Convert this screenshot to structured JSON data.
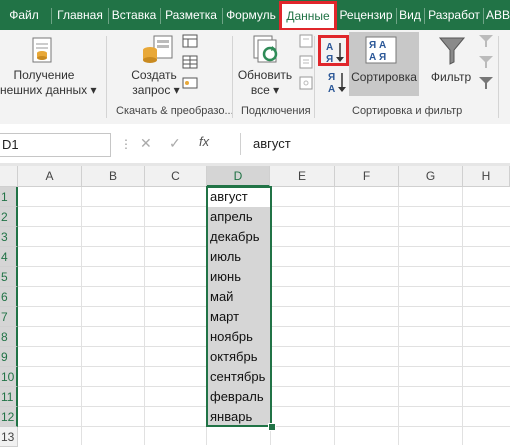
{
  "tabs": [
    "Файл",
    "Главная",
    "Вставка",
    "Разметка",
    "Формуль",
    "Данные",
    "Рецензир",
    "Вид",
    "Разработ",
    "ABB"
  ],
  "ribbon": {
    "get_data_line1": "Получение",
    "get_data_line2": "нешних данных",
    "create_query_line1": "Создать",
    "create_query_line2": "запрос",
    "group_get_transform": "Скачать & преобразо...",
    "refresh_line1": "Обновить",
    "refresh_line2": "все",
    "group_connections": "Подключения",
    "sort_label": "Сортировка",
    "filter_label": "Фильтр",
    "group_sort_filter": "Сортировка и фильтр",
    "sort_az_top": "А",
    "sort_az_bottom": "Я",
    "sort_za_top": "Я",
    "sort_za_bottom": "А"
  },
  "formula_bar": {
    "name_box": "D1",
    "fx": "fx",
    "value": "август"
  },
  "columns": [
    "A",
    "B",
    "C",
    "D",
    "E",
    "F",
    "G",
    "H"
  ],
  "rows": [
    "1",
    "2",
    "3",
    "4",
    "5",
    "6",
    "7",
    "8",
    "9",
    "10",
    "11",
    "12",
    "13"
  ],
  "cells_D": [
    "август",
    "апрель",
    "декабрь",
    "июль",
    "июнь",
    "май",
    "март",
    "ноябрь",
    "октябрь",
    "сентябрь",
    "февраль",
    "январь"
  ],
  "colors": {
    "accent": "#217346",
    "highlight": "#e0262b"
  }
}
